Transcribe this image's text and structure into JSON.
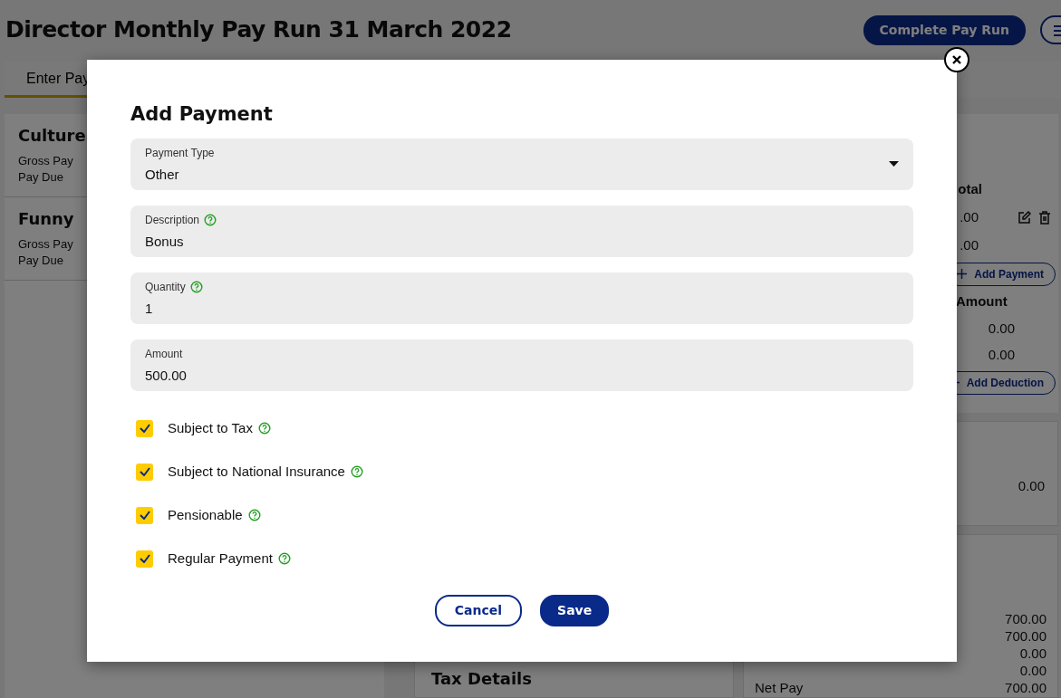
{
  "page": {
    "title": "Director Monthly Pay Run 31 March 2022",
    "complete_button": "Complete Pay Run",
    "tabs": [
      {
        "label": "Enter Pay",
        "selected": true
      }
    ],
    "employees": [
      {
        "name": "Culture",
        "lines": [
          "Gross Pay",
          "Pay Due"
        ]
      },
      {
        "name": "Funny",
        "lines": [
          "Gross Pay",
          "Pay Due"
        ]
      }
    ],
    "payments": {
      "column": "otal",
      "rows": [
        {
          "value": ".00",
          "actions": true
        },
        {
          "value": ".00",
          "actions": false
        }
      ],
      "add_button": "Add Payment"
    },
    "deductions": {
      "column": "Amount",
      "rows": [
        "0.00",
        "0.00"
      ],
      "add_button": "Add Deduction"
    },
    "panel_value": "0.00",
    "summary": [
      {
        "value": "700.00"
      },
      {
        "value": "700.00"
      },
      {
        "value": "0.00"
      },
      {
        "value": "0.00"
      },
      {
        "label": "Net Pay",
        "value": "700.00"
      }
    ],
    "tax_details": {
      "title": "Tax Details"
    }
  },
  "modal": {
    "title": "Add Payment",
    "fields": [
      {
        "kind": "select",
        "label": "Payment Type",
        "value": "Other",
        "help": false
      },
      {
        "kind": "text",
        "label": "Description",
        "value": "Bonus",
        "help": true
      },
      {
        "kind": "text",
        "label": "Quantity",
        "value": "1",
        "help": true
      },
      {
        "kind": "text",
        "label": "Amount",
        "value": "500.00",
        "help": false
      }
    ],
    "checkboxes": [
      {
        "label": "Subject to Tax",
        "checked": true
      },
      {
        "label": "Subject to National Insurance",
        "checked": true
      },
      {
        "label": "Pensionable",
        "checked": true
      },
      {
        "label": "Regular Payment",
        "checked": true
      }
    ],
    "buttons": [
      {
        "label": "Cancel",
        "kind": "secondary"
      },
      {
        "label": "Save",
        "kind": "primary"
      }
    ]
  }
}
